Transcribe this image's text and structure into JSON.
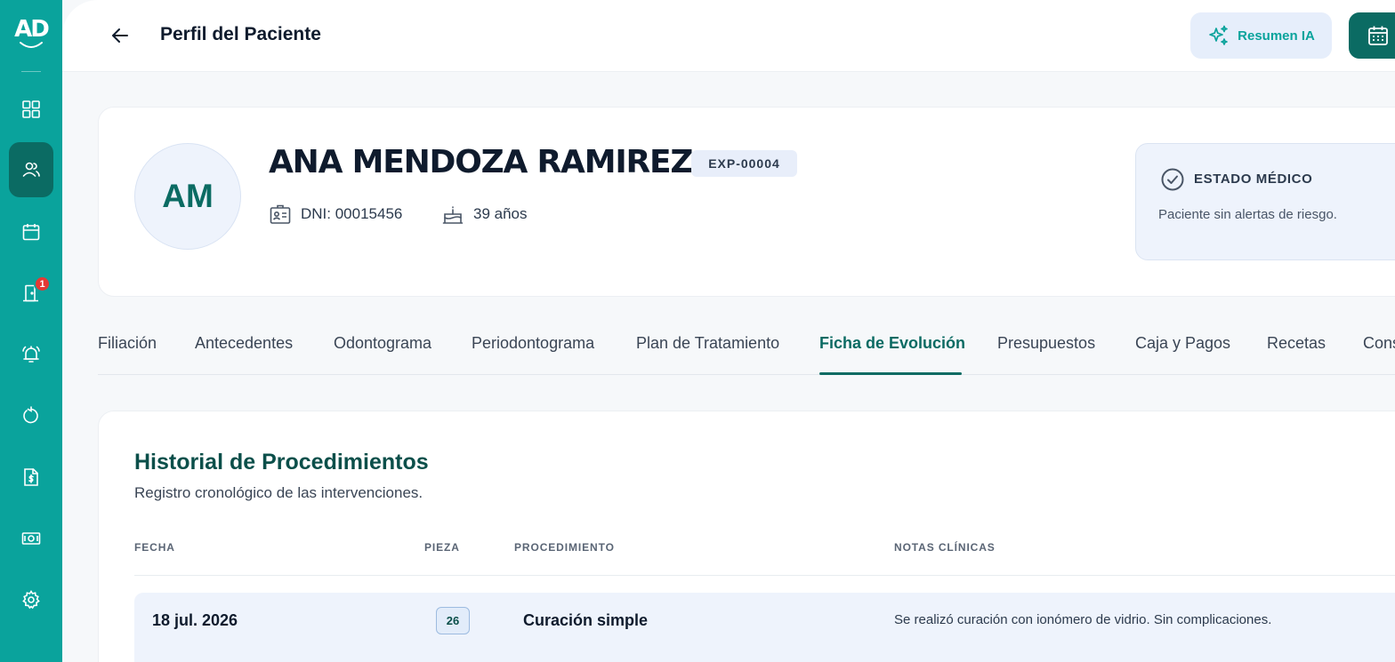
{
  "app": {
    "logo_text": "AD"
  },
  "sidebar": {
    "items": [
      {
        "icon": "dashboard-icon",
        "active": false
      },
      {
        "icon": "patients-icon",
        "active": true
      },
      {
        "icon": "calendar-icon",
        "active": false
      },
      {
        "icon": "door-icon",
        "active": false,
        "badge": "1"
      },
      {
        "icon": "bell-icon",
        "active": false
      },
      {
        "icon": "history-icon",
        "active": false
      },
      {
        "icon": "invoice-icon",
        "active": false
      },
      {
        "icon": "money-icon",
        "active": false
      },
      {
        "icon": "settings-icon",
        "active": false
      }
    ]
  },
  "header": {
    "title": "Perfil del Paciente",
    "ai_button_label": "Resumen IA"
  },
  "patient": {
    "initials": "AM",
    "name": "ANA MENDOZA RAMIREZ",
    "record_id": "EXP-00004",
    "dni": "DNI: 00015456",
    "age": "39 años",
    "medical_status": {
      "title": "ESTADO MÉDICO",
      "text": "Paciente sin alertas de riesgo."
    }
  },
  "tabs": [
    "Filiación",
    "Antecedentes",
    "Odontograma",
    "Periodontograma",
    "Plan de Tratamiento",
    "Ficha de Evolución",
    "Presupuestos",
    "Caja y Pagos",
    "Recetas",
    "Cons"
  ],
  "active_tab": "Ficha de Evolución",
  "history": {
    "title": "Historial de Procedimientos",
    "subtitle": "Registro cronológico de las intervenciones.",
    "columns": [
      "FECHA",
      "PIEZA",
      "PROCEDIMIENTO",
      "NOTAS CLÍNICAS"
    ],
    "rows": [
      {
        "date": "18 jul. 2026",
        "tooth": "26",
        "procedure": "Curación simple",
        "notes": "Se realizó curación con ionómero de vidrio. Sin complicaciones."
      }
    ]
  },
  "colors": {
    "sidebar": "#0aa39c",
    "accent_dark": "#0b6b63",
    "soft_blue": "#eef3fc"
  }
}
